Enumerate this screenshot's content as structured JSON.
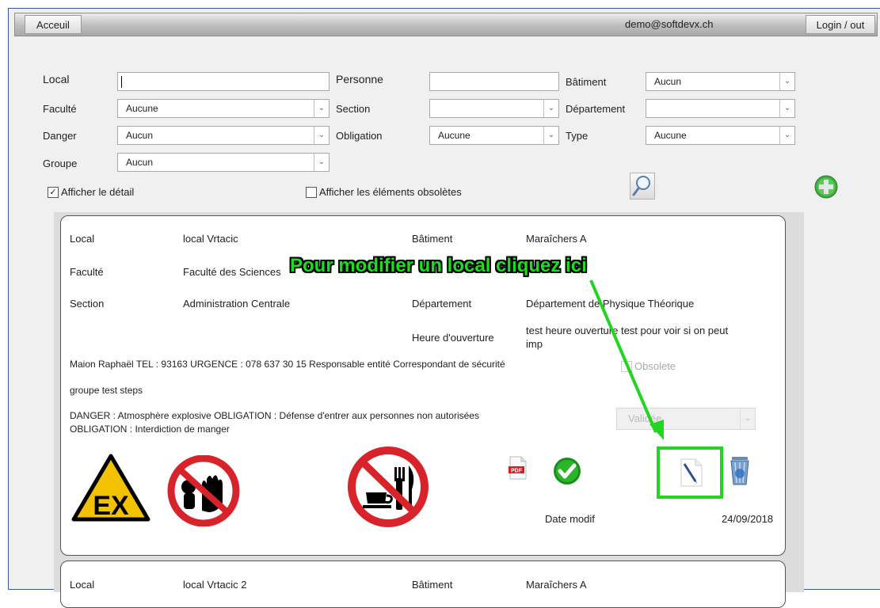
{
  "header": {
    "home_label": "Acceuil",
    "user_email": "demo@softdevx.ch",
    "login_label": "Login / out"
  },
  "filters": {
    "local_label": "Local",
    "local_value": "",
    "personne_label": "Personne",
    "personne_value": "",
    "batiment_label": "Bâtiment",
    "batiment_value": "Aucun",
    "faculte_label": "Faculté",
    "faculte_value": "Aucune",
    "section_label": "Section",
    "section_value": "",
    "departement_label": "Département",
    "departement_value": "",
    "danger_label": "Danger",
    "danger_value": "Aucun",
    "obligation_label": "Obligation",
    "obligation_value": "Aucune",
    "type_label": "Type",
    "type_value": "Aucune",
    "groupe_label": "Groupe",
    "groupe_value": "Aucun",
    "show_detail_label": "Afficher le détail",
    "show_detail_checked": true,
    "show_obsolete_label": "Afficher les éléments obsolètes",
    "show_obsolete_checked": false
  },
  "cards": [
    {
      "local_label": "Local",
      "local_value": "local Vrtacic",
      "batiment_label": "Bâtiment",
      "batiment_value": "Maraîchers A",
      "faculte_label": "Faculté",
      "faculte_value": "Faculté des Sciences",
      "section_label": "Section",
      "section_value": "Administration Centrale",
      "departement_label": "Département",
      "departement_value": "Département de Physique Théorique",
      "heure_label": "Heure d'ouverture",
      "heure_value_line1": "test heure ouverture test pour voir si on peut",
      "heure_value_line2": "imp",
      "contacts": "Maion Raphaël TEL : 93163 URGENCE : 078 637 30 15 Responsable entité Correspondant de sécurité",
      "obsolete_label": "Obsolete",
      "groupe": "groupe test steps",
      "danger_line1": "DANGER : Atmosphère explosive OBLIGATION : Défense d'entrer aux personnes non autorisées",
      "danger_line2": "OBLIGATION : Interdiction de manger",
      "status_value": "Validée",
      "date_label": "Date modif",
      "date_value": "24/09/2018",
      "pdf_text": "PDF"
    },
    {
      "local_label": "Local",
      "local_value": "local Vrtacic 2",
      "batiment_label": "Bâtiment",
      "batiment_value": "Maraîchers A"
    }
  ],
  "annotation": {
    "text": "Pour modifier un local cliquez ici"
  },
  "sign_texts": {
    "explosive": "EX"
  },
  "colors": {
    "annotation": "#1edc1e",
    "highlight": "#23d423",
    "header_border": "#3a5a9a"
  }
}
